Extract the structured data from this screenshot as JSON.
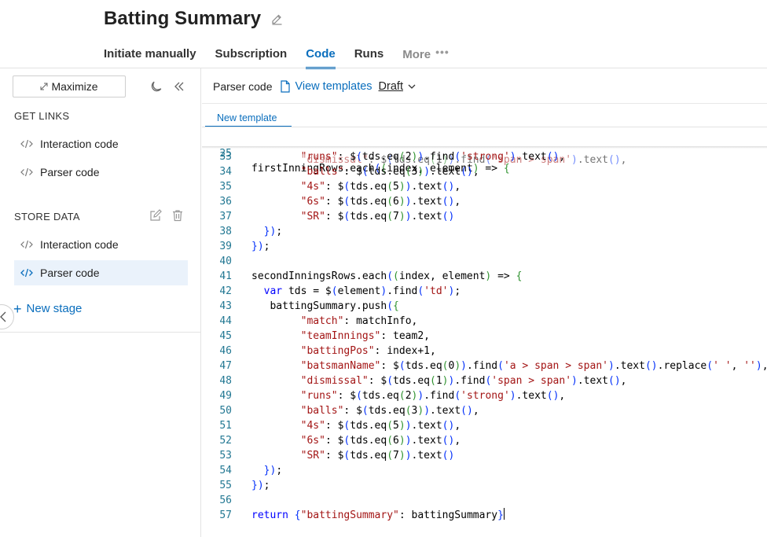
{
  "header": {
    "title": "Batting Summary",
    "edit_icon": "pencil-icon"
  },
  "tabs": [
    {
      "label": "Initiate manually",
      "active": false
    },
    {
      "label": "Subscription",
      "active": false
    },
    {
      "label": "Code",
      "active": true
    },
    {
      "label": "Runs",
      "active": false
    },
    {
      "label": "More",
      "active": false,
      "icon": "ellipsis-icon"
    }
  ],
  "sidebar": {
    "maximize_label": "Maximize",
    "get_links": {
      "label": "GET LINKS",
      "items": [
        {
          "label": "Interaction code",
          "icon": "code-icon",
          "selected": false
        },
        {
          "label": "Parser code",
          "icon": "code-icon",
          "selected": false
        }
      ]
    },
    "store_data": {
      "label": "STORE DATA",
      "items": [
        {
          "label": "Interaction code",
          "icon": "code-icon",
          "selected": false
        },
        {
          "label": "Parser code",
          "icon": "code-icon",
          "selected": true
        }
      ]
    },
    "new_stage_label": "New stage"
  },
  "editor": {
    "toolbar": {
      "label": "Parser code",
      "view_templates_label": "View templates",
      "version_label": "Draft"
    },
    "template_tab_label": "New template",
    "sticky_line": {
      "number": "25",
      "text": "firstInningRows.each((index, element) => {"
    },
    "lines": [
      {
        "number": "33",
        "text": "        \"runs\": $(tds.eq(2)).find('strong').text(),"
      },
      {
        "number": "34",
        "text": "        \"balls\": $(tds.eq(3)).text(),"
      },
      {
        "number": "35",
        "text": "        \"4s\": $(tds.eq(5)).text(),"
      },
      {
        "number": "36",
        "text": "        \"6s\": $(tds.eq(6)).text(),"
      },
      {
        "number": "37",
        "text": "        \"SR\": $(tds.eq(7)).text()"
      },
      {
        "number": "38",
        "text": "  });"
      },
      {
        "number": "39",
        "text": "});"
      },
      {
        "number": "40",
        "text": ""
      },
      {
        "number": "41",
        "text": "secondInningsRows.each((index, element) => {"
      },
      {
        "number": "42",
        "text": "  var tds = $(element).find('td');"
      },
      {
        "number": "43",
        "text": "   battingSummary.push({"
      },
      {
        "number": "44",
        "text": "        \"match\": matchInfo,"
      },
      {
        "number": "45",
        "text": "        \"teamInnings\": team2,"
      },
      {
        "number": "46",
        "text": "        \"battingPos\": index+1,"
      },
      {
        "number": "47",
        "text": "        \"batsmanName\": $(tds.eq(0)).find('a > span > span').text().replace(' ', ''),"
      },
      {
        "number": "48",
        "text": "        \"dismissal\": $(tds.eq(1)).find('span > span').text(),"
      },
      {
        "number": "49",
        "text": "        \"runs\": $(tds.eq(2)).find('strong').text(),"
      },
      {
        "number": "50",
        "text": "        \"balls\": $(tds.eq(3)).text(),"
      },
      {
        "number": "51",
        "text": "        \"4s\": $(tds.eq(5)).text(),"
      },
      {
        "number": "52",
        "text": "        \"6s\": $(tds.eq(6)).text(),"
      },
      {
        "number": "53",
        "text": "        \"SR\": $(tds.eq(7)).text()"
      },
      {
        "number": "54",
        "text": "  });"
      },
      {
        "number": "55",
        "text": "});"
      },
      {
        "number": "56",
        "text": ""
      },
      {
        "number": "57",
        "text": "return {\"battingSummary\": battingSummary}"
      }
    ],
    "partial_line_text": "        \"dismissal\": $(tds.eq(1)).find('span > span').text(),"
  },
  "colors": {
    "accent": "#0a6ebd",
    "selected_bg": "#eaf2fb",
    "keyword": "#0000ff",
    "string": "#a31515",
    "line_number": "#237893"
  }
}
